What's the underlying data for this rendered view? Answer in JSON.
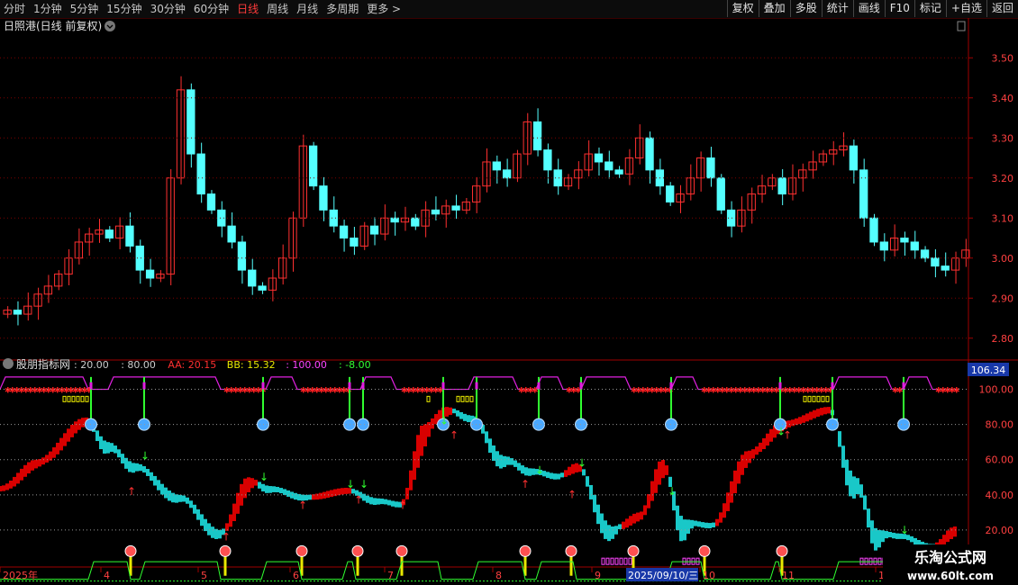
{
  "toolbar": {
    "periods": [
      "分时",
      "1分钟",
      "5分钟",
      "15分钟",
      "30分钟",
      "60分钟",
      "日线",
      "周线",
      "月线",
      "多周期",
      "更多 >"
    ],
    "active_period": "日线",
    "buttons": [
      "复权",
      "叠加",
      "多股",
      "统计",
      "画线",
      "F10",
      "标记",
      "+自选",
      "返回"
    ]
  },
  "main_pane": {
    "title": "日照港(日线 前复权)",
    "y_ticks": [
      "3.50",
      "3.40",
      "3.30",
      "3.20",
      "3.10",
      "3.00",
      "2.90",
      "2.80"
    ]
  },
  "indicator_pane": {
    "name": "股朋指标网",
    "params": [
      {
        "label": ":",
        "value": "20.00",
        "color": "#cccccc"
      },
      {
        "label": ":",
        "value": "80.00",
        "color": "#cccccc"
      },
      {
        "label": "AA:",
        "value": "20.15",
        "color": "#ff3030"
      },
      {
        "label": "BB:",
        "value": "15.32",
        "color": "#e8e800"
      },
      {
        "label": ":",
        "value": "100.00",
        "color": "#ff44ff"
      },
      {
        "label": ":",
        "value": "-8.00",
        "color": "#33ff33"
      }
    ],
    "y_ticks": [
      "100.00",
      "80.00",
      "60.00",
      "40.00",
      "20.00"
    ],
    "current_value": "106.34"
  },
  "x_axis": {
    "labels": [
      "2025年",
      "4",
      "5",
      "6",
      "7",
      "8",
      "9",
      "2025/09/10/三",
      "10",
      "11",
      "1"
    ]
  },
  "watermark": {
    "title": "乐淘公式网",
    "url": "www.60lt.com"
  },
  "colors": {
    "up": "#ff3030",
    "down": "#54ffff",
    "band_up": "#d80000",
    "band_down": "#19c8c8",
    "grid": "#7a0000",
    "axis": "#a00000"
  },
  "chart_data": {
    "type": "candlestick",
    "y_range": [
      2.75,
      3.55
    ],
    "closes": [
      2.87,
      2.86,
      2.88,
      2.91,
      2.93,
      2.96,
      3.0,
      3.04,
      3.06,
      3.07,
      3.05,
      3.08,
      3.03,
      2.97,
      2.95,
      2.96,
      3.2,
      3.42,
      3.26,
      3.16,
      3.12,
      3.08,
      3.04,
      2.97,
      2.93,
      2.92,
      2.95,
      3.0,
      3.1,
      3.28,
      3.18,
      3.12,
      3.08,
      3.05,
      3.03,
      3.08,
      3.06,
      3.1,
      3.09,
      3.1,
      3.08,
      3.12,
      3.11,
      3.13,
      3.12,
      3.14,
      3.18,
      3.24,
      3.22,
      3.2,
      3.26,
      3.34,
      3.27,
      3.22,
      3.18,
      3.2,
      3.22,
      3.26,
      3.24,
      3.22,
      3.21,
      3.25,
      3.3,
      3.22,
      3.18,
      3.14,
      3.16,
      3.2,
      3.25,
      3.2,
      3.12,
      3.08,
      3.12,
      3.16,
      3.18,
      3.2,
      3.16,
      3.2,
      3.22,
      3.24,
      3.26,
      3.27,
      3.28,
      3.22,
      3.1,
      3.04,
      3.02,
      3.05,
      3.04,
      3.02,
      3.0,
      2.98,
      2.97,
      3.0,
      3.02
    ]
  }
}
